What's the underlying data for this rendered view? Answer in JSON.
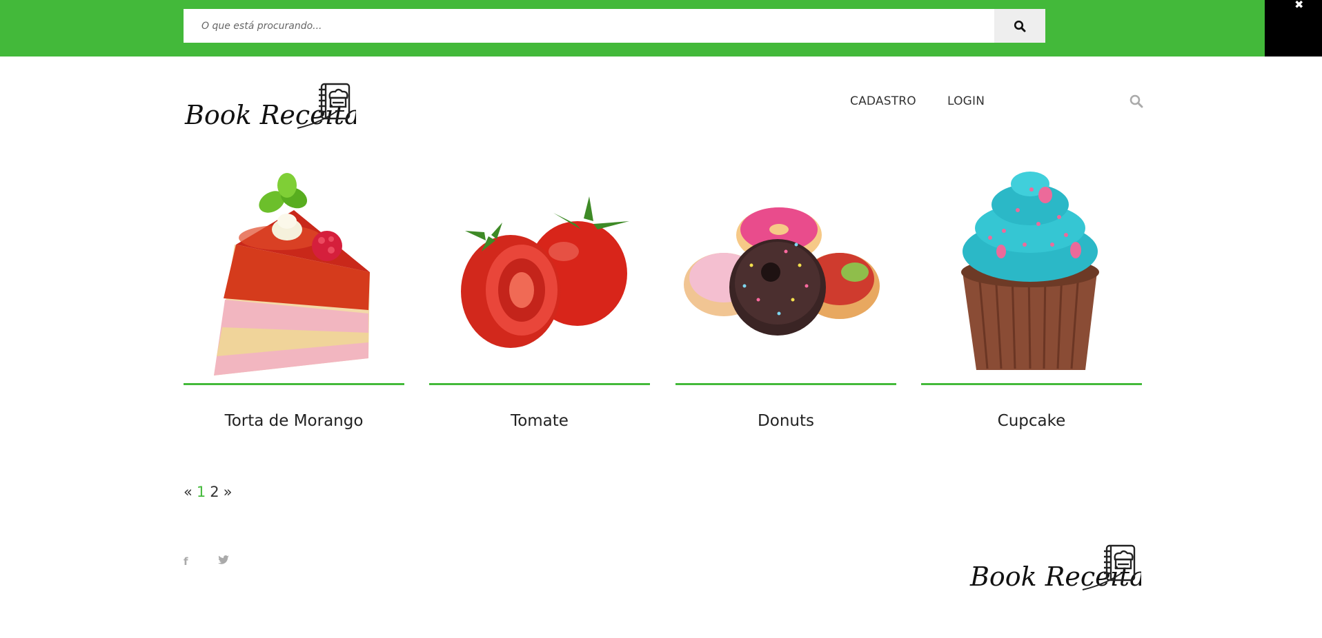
{
  "search": {
    "placeholder": "O que está procurando...",
    "close_label": "✖"
  },
  "header": {
    "logo_text": "Book Receitas",
    "nav": [
      {
        "label": "CADASTRO"
      },
      {
        "label": "LOGIN"
      }
    ]
  },
  "recipes": [
    {
      "title": "Torta de Morango",
      "image": "strawberry-cake-slice"
    },
    {
      "title": "Tomate",
      "image": "tomatoes"
    },
    {
      "title": "Donuts",
      "image": "donuts"
    },
    {
      "title": "Cupcake",
      "image": "cupcake"
    }
  ],
  "pagination": {
    "prev": "«",
    "pages": [
      "1",
      "2"
    ],
    "current": "1",
    "next": "»"
  },
  "footer": {
    "social": [
      {
        "icon": "facebook-icon",
        "glyph": "f"
      },
      {
        "icon": "twitter-icon",
        "glyph": "🐦"
      }
    ],
    "logo_text": "Book Receitas"
  },
  "colors": {
    "accent": "#43b93a",
    "close_bg": "#000000",
    "search_button_bg": "#eeeeee"
  }
}
